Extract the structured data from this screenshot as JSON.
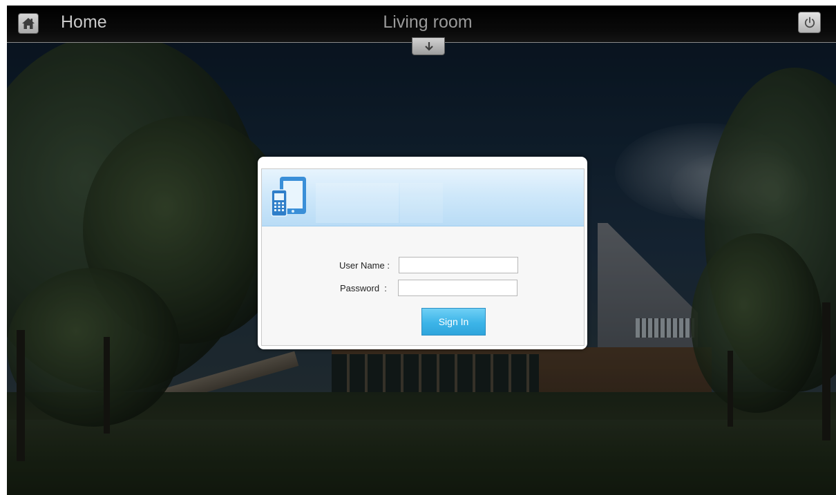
{
  "header": {
    "home_label": "Home",
    "room_title": "Living room"
  },
  "login": {
    "username_label": "User Name :",
    "username_value": "",
    "password_label": "Password  :",
    "password_value": "",
    "signin_label": "Sign In"
  },
  "colors": {
    "topbar_background": "#000000",
    "dialog_header_blue": "#cfe8fa",
    "signin_button_blue": "#3cb4e8"
  },
  "icons": {
    "home": "home-icon",
    "power": "power-icon",
    "down": "arrow-down-icon",
    "devices": "tablet-phone-icon"
  }
}
